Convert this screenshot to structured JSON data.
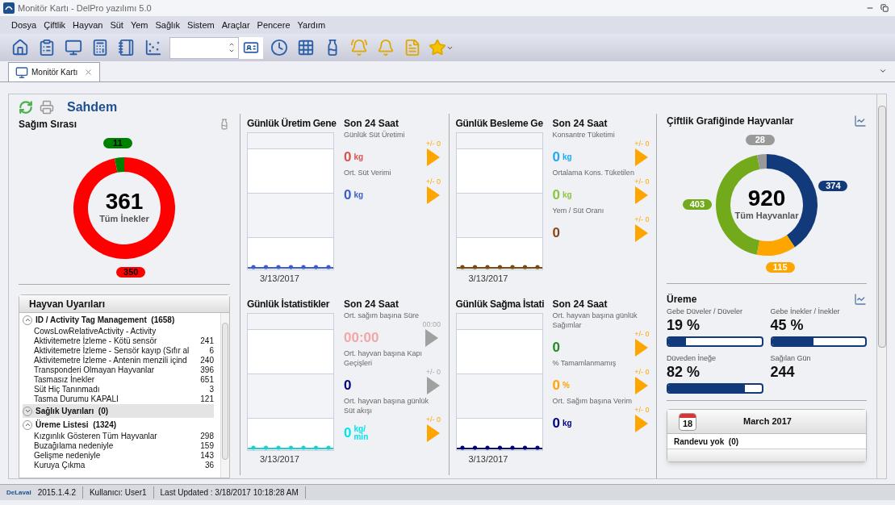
{
  "window": {
    "title": "Monitör Kartı - DelPro yazılımı 5.0"
  },
  "menu": [
    "Dosya",
    "Çiftlik",
    "Hayvan",
    "Süt",
    "Yem",
    "Sağlık",
    "Sistem",
    "Araçlar",
    "Pencere",
    "Yardım"
  ],
  "document_tabs": [
    {
      "label": "Monitör Kartı",
      "selected": true
    }
  ],
  "header": {
    "title": "Sahdem"
  },
  "milking_queue": {
    "title": "Sağım Sırası",
    "total": "361",
    "total_label": "Tüm İnekler",
    "chart_data": {
      "type": "donut",
      "data_labels": true,
      "values": [
        350,
        11
      ]
    },
    "slices": [
      {
        "color": "#ff0000"
      },
      {
        "color": "#008000"
      }
    ]
  },
  "alerts": {
    "title": "Hayvan Uyarıları",
    "groups": [
      {
        "title": "ID / Activity Tag Management  (1658)",
        "expanded": true,
        "selected": false,
        "items": [
          {
            "name": "CowsLowRelativeActivity - Activity"
          },
          {
            "name": "Aktivitemetre İzleme - Kötü sensör",
            "count": "241"
          },
          {
            "name": "Aktivitemetre İzleme - Sensör kayıp (Sıfır al",
            "count": "6"
          },
          {
            "name": "Aktivitemetre İzleme - Antenin menzili içind",
            "count": "240"
          },
          {
            "name": "Transponderi Olmayan Hayvanlar",
            "count": "396"
          },
          {
            "name": "Tasmasız İnekler",
            "count": "651"
          },
          {
            "name": "Süt Hiç Tanınmadı",
            "count": "3"
          },
          {
            "name": "Tasma Durumu KAPALI",
            "count": "121"
          }
        ]
      },
      {
        "title": "Sağlık Uyarıları  (0)",
        "expanded": false,
        "selected": true
      },
      {
        "title": "Üreme Listesi  (1324)",
        "expanded": true,
        "selected": false,
        "items": [
          {
            "name": "Kızgınlık Gösteren Tüm Hayvanlar",
            "count": "298"
          },
          {
            "name": "Buzağılama nedeniyle",
            "count": "159"
          },
          {
            "name": "Gelişme nedeniyle",
            "count": "143"
          },
          {
            "name": "Kuruya Çıkma",
            "count": "36"
          }
        ]
      }
    ]
  },
  "panels": [
    {
      "title": "Günlük Üretim Gene",
      "period": "Son 24 Saat",
      "date": "3/13/2017",
      "color": "#3a5fcd",
      "metrics": [
        {
          "label": "Günlük Süt Üretimi",
          "value": "0",
          "unit": "kg",
          "color": "#d9534f",
          "delta": "+/- 0",
          "disabled": false
        },
        {
          "label": "Ort. Süt Verimi",
          "value": "0",
          "unit": "kg",
          "color": "#3a5fcd",
          "delta": "+/- 0",
          "disabled": false
        }
      ]
    },
    {
      "title": "Günlük Besleme Ge",
      "period": "Son 24 Saat",
      "date": "3/13/2017",
      "color": "#7a4a10",
      "metrics": [
        {
          "label": "Konsantre Tüketimi",
          "value": "0",
          "unit": "kg",
          "color": "#1eaaf1",
          "delta": "+/- 0",
          "disabled": false
        },
        {
          "label": "Ortalama Kons. Tüketilen",
          "value": "0",
          "unit": "kg",
          "color": "#8cc63f",
          "delta": "+/- 0",
          "disabled": false
        },
        {
          "label": "Yem / Süt Oranı",
          "value": "0",
          "color": "#8b4513",
          "delta": "+/- 0",
          "disabled": false
        }
      ]
    },
    {
      "title": "Günlük İstatistikler",
      "period": "Son 24 Saat",
      "date": "3/13/2017",
      "color": "#1ecfcf",
      "metrics": [
        {
          "label": "Ort. sağım başına Süre",
          "value": "00:00",
          "color": "#f4a6a6",
          "delta": "00:00",
          "disabled": true
        },
        {
          "label": "Ort. hayvan başına Kapı Geçişleri",
          "value": "0",
          "color": "#000080",
          "delta": "+/- 0",
          "disabled": true
        },
        {
          "label": "Ort. hayvan başına günlük Süt akışı",
          "value": "0",
          "unit": "kg/ min",
          "color": "#00e5ee",
          "delta": "+/- 0",
          "disabled": false
        }
      ]
    },
    {
      "title": "Günlük Sağma İstati",
      "period": "Son 24 Saat",
      "date": "3/13/2017",
      "color": "#000080",
      "metrics": [
        {
          "label": "Ort. hayvan başına günlük Sağımlar",
          "value": "0",
          "color": "#228b22",
          "delta": "+/- 0",
          "disabled": false
        },
        {
          "label": "% Tamamlanmamış",
          "value": "0",
          "unit": "%",
          "color": "#ffa500",
          "delta": "+/- 0",
          "disabled": false
        },
        {
          "label": "Ort. Sağım başına Verim",
          "value": "0",
          "unit": "kg",
          "color": "#000080",
          "delta": "+/- 0",
          "disabled": false
        }
      ]
    }
  ],
  "farm_animals": {
    "title": "Çiftlik Grafiğinde Hayvanlar",
    "total": "920",
    "total_label": "Tüm Hayvanlar",
    "chart_data": {
      "type": "donut",
      "data_labels": true,
      "values": [
        374,
        115,
        403,
        28
      ]
    },
    "slices": [
      {
        "color": "#123a7a"
      },
      {
        "color": "#ffa500"
      },
      {
        "color": "#72aa1c"
      },
      {
        "color": "#999999"
      }
    ]
  },
  "reproduction": {
    "title": "Üreme",
    "stats": [
      {
        "label": "Gebe Düveler / Düveler",
        "value": "19 %",
        "level": 0.19
      },
      {
        "label": "Gebe İnekler / İnekler",
        "value": "45 %",
        "level": 0.45
      },
      {
        "label": "Düveden İneğe",
        "value": "82 %",
        "level": 0.82
      },
      {
        "label": "Sağılan Gün",
        "value": "244"
      }
    ]
  },
  "calendar": {
    "day": "18",
    "month": "March 2017",
    "appointments": "Randevu yok  (0)"
  },
  "status_bar": {
    "brand": "DeLaval",
    "version": "2015.1.4.2",
    "user": "Kullanıcı: User1",
    "last_updated": "Last Updated : 3/18/2017 10:18:28 AM"
  }
}
